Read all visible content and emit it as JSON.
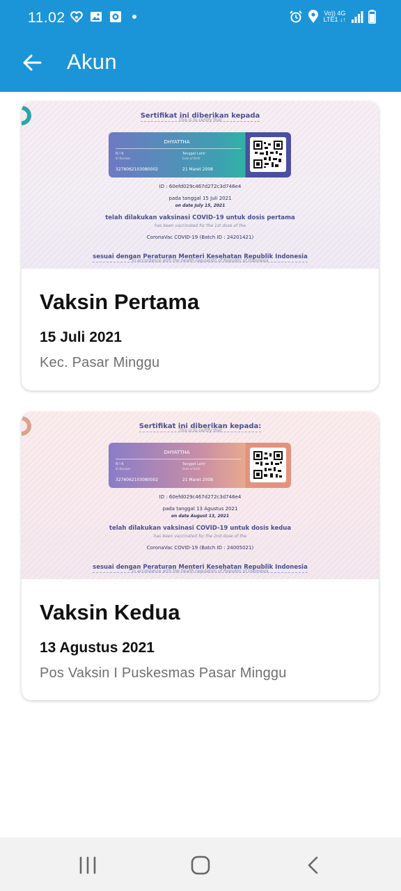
{
  "status_bar": {
    "time": "11.02",
    "network_top": "Vo)) 4G",
    "network_bottom": "LTE1 ↓↑",
    "icons": [
      "heart-app-icon",
      "gallery-icon",
      "camera-app-icon",
      "alarm-icon",
      "location-icon",
      "signal-icon",
      "battery-icon"
    ]
  },
  "app_bar": {
    "title": "Akun",
    "color": "#1b95d8"
  },
  "cards": [
    {
      "certificate": {
        "heading": "Sertifikat ini diberikan kepada",
        "heading_en": "This is to certify that",
        "name": "DHYATTHA",
        "nik_label": "N I K",
        "nik_label_en": "ID Number",
        "dob_label": "Tanggal Lahir",
        "dob_label_en": "Date of Birth",
        "nik": "3276062103080002",
        "dob": "21 Maret 2008",
        "id": "ID : 60efd029c467d272c3d746e4",
        "date_line": "pada tanggal 15 Juli 2021",
        "date_line_en": "on date July 15, 2021",
        "vaccinated": "telah dilakukan vaksinasi COVID-19 untuk dosis pertama",
        "vaccinated_en": "has been vaccinated for the 1st dose of the",
        "vaccine": "CoronaVac COVID-19 (Batch ID : 24201421)",
        "regulation": "sesuai dengan Peraturan Menteri Kesehatan Republik Indonesia",
        "regulation_en": "in accordance with the health regulation of Republic of Indonesia"
      },
      "title": "Vaksin Pertama",
      "date": "15 Juli 2021",
      "location": "Kec. Pasar Minggu"
    },
    {
      "certificate": {
        "heading": "Sertifikat ini diberikan kepada:",
        "heading_en": "This is to certify that",
        "name": "DHYATTHA",
        "nik_label": "N I K",
        "nik_label_en": "ID Number",
        "dob_label": "Tanggal Lahir",
        "dob_label_en": "Date of Birth",
        "nik": "3276062103080002",
        "dob": "21 Maret 2008",
        "id": "ID : 60efd029c467d272c3d746e4",
        "date_line": "pada tanggal 13 Agustus 2021",
        "date_line_en": "on date August 13, 2021",
        "vaccinated": "telah dilakukan vaksinasi COVID-19 untuk dosis kedua",
        "vaccinated_en": "has been vaccinated for the 2nd dose of the",
        "vaccine": "CoronaVac COVID-19 (Batch ID : 24005021)",
        "regulation": "sesuai dengan Peraturan Menteri Kesehatan Republik Indonesia",
        "regulation_en": "in accordance with the health regulation of Republic of Indonesia"
      },
      "title": "Vaksin Kedua",
      "date": "13 Agustus 2021",
      "location": "Pos Vaksin I Puskesmas Pasar Minggu"
    }
  ],
  "nav_bar": {
    "icons": [
      "recent-apps-icon",
      "home-icon",
      "back-icon"
    ]
  }
}
